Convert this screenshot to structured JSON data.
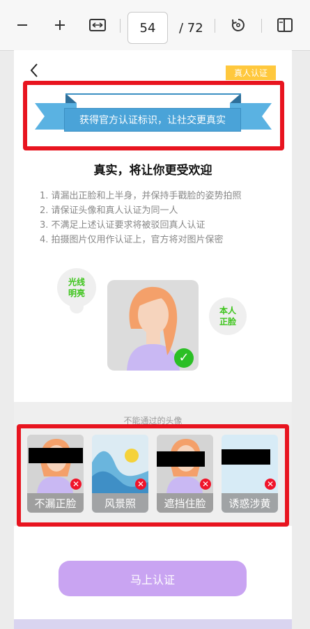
{
  "toolbar": {
    "zoom_out_icon": "minus-icon",
    "zoom_in_icon": "plus-icon",
    "fit_icon": "fit-width-icon",
    "page_number": "54",
    "page_total": "/ 72",
    "rotate_icon": "rotate-icon",
    "view_icon": "page-view-icon"
  },
  "page": {
    "back_icon": "chevron-left-icon",
    "badge": "真人认证",
    "banner_text": "获得官方认证标识，让社交更真实",
    "title": "真实，将让你更受欢迎",
    "rules": [
      "1.  请漏出正脸和上半身，并保持手戳脸的姿势拍照",
      "2.  请保证头像和真人认证为同一人",
      "3.  不满足上述认证要求将被驳回真人认证",
      "4.  拍摄图片仅用作认证上，官方将对图片保密"
    ],
    "bubble_light_line1": "光线",
    "bubble_light_line2": "明亮",
    "bubble_face_line1": "本人",
    "bubble_face_line2": "正脸",
    "check_mark": "✓",
    "bad_title": "不能通过的头像",
    "bad_items": [
      {
        "label": "不漏正脸"
      },
      {
        "label": "风景照"
      },
      {
        "label": "遮挡住脸"
      },
      {
        "label": "诱惑涉黄"
      }
    ],
    "x_mark": "✕",
    "cta": "马上认证"
  },
  "colors": {
    "highlight_red": "#e8141f",
    "badge_yellow": "#ffc83d",
    "banner_blue": "#4aa3d8",
    "cta_purple": "#c9a4f2",
    "ok_green": "#3cc41a"
  }
}
